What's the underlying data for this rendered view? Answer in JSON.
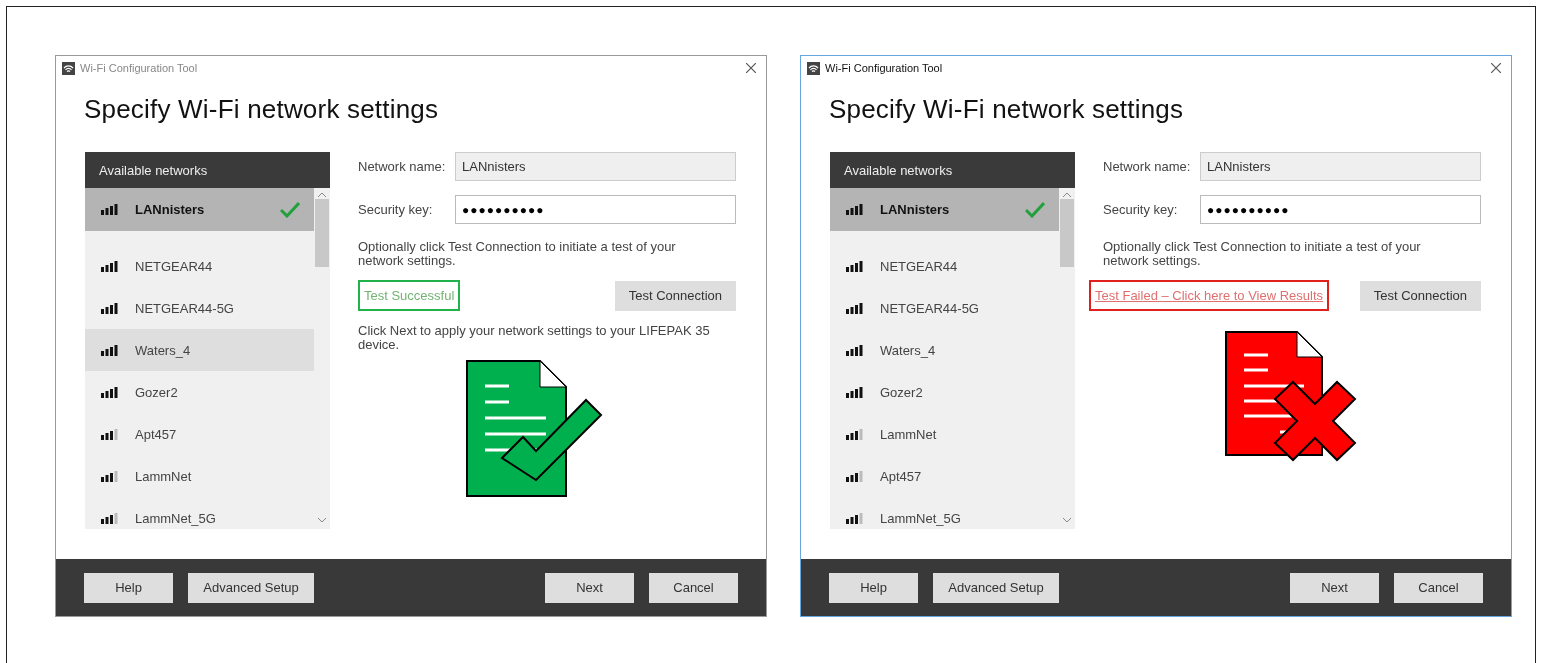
{
  "windows": [
    {
      "active": false,
      "title": "Wi-Fi Configuration Tool",
      "heading": "Specify Wi-Fi network settings",
      "networks_header": "Available networks",
      "networks": [
        {
          "name": "LANnisters",
          "selected": true,
          "hovered": false,
          "kind": "strong"
        },
        {
          "name": "NETGEAR44",
          "selected": false,
          "hovered": false,
          "kind": "strong"
        },
        {
          "name": "NETGEAR44-5G",
          "selected": false,
          "hovered": false,
          "kind": "strong"
        },
        {
          "name": "Waters_4",
          "selected": false,
          "hovered": true,
          "kind": "strong"
        },
        {
          "name": "Gozer2",
          "selected": false,
          "hovered": false,
          "kind": "strong"
        },
        {
          "name": "Apt457",
          "selected": false,
          "hovered": false,
          "kind": "weak"
        },
        {
          "name": "LammNet",
          "selected": false,
          "hovered": false,
          "kind": "weak"
        },
        {
          "name": "LammNet_5G",
          "selected": false,
          "hovered": false,
          "kind": "weak"
        }
      ],
      "network_name_label": "Network name:",
      "network_name": "LANnisters",
      "security_key_label": "Security key:",
      "security_key": "●●●●●●●●●●",
      "hint": "Optionally click Test Connection to initiate a test of your network settings.",
      "test_result": {
        "kind": "success",
        "text": "Test Successful"
      },
      "test_button": "Test Connection",
      "next_hint": "Click Next to apply your network settings to your LIFEPAK 35 device.",
      "footer_left": [
        "Help",
        "Advanced Setup"
      ],
      "footer_right": [
        "Next",
        "Cancel"
      ]
    },
    {
      "active": true,
      "title": "Wi-Fi Configuration Tool",
      "heading": "Specify Wi-Fi network settings",
      "networks_header": "Available networks",
      "networks": [
        {
          "name": "LANnisters",
          "selected": true,
          "hovered": false,
          "kind": "strong"
        },
        {
          "name": "NETGEAR44",
          "selected": false,
          "hovered": false,
          "kind": "strong"
        },
        {
          "name": "NETGEAR44-5G",
          "selected": false,
          "hovered": false,
          "kind": "strong"
        },
        {
          "name": "Waters_4",
          "selected": false,
          "hovered": false,
          "kind": "strong"
        },
        {
          "name": "Gozer2",
          "selected": false,
          "hovered": false,
          "kind": "strong"
        },
        {
          "name": "LammNet",
          "selected": false,
          "hovered": false,
          "kind": "weak"
        },
        {
          "name": "Apt457",
          "selected": false,
          "hovered": false,
          "kind": "weak"
        },
        {
          "name": "LammNet_5G",
          "selected": false,
          "hovered": false,
          "kind": "weak"
        }
      ],
      "network_name_label": "Network name:",
      "network_name": "LANnisters",
      "security_key_label": "Security key:",
      "security_key": "●●●●●●●●●●",
      "hint": "Optionally click Test Connection to initiate a test of your network settings.",
      "test_result": {
        "kind": "failure",
        "text": "Test Failed – Click here to View Results"
      },
      "test_button": "Test Connection",
      "footer_left": [
        "Help",
        "Advanced Setup"
      ],
      "footer_right": [
        "Next",
        "Cancel"
      ]
    }
  ]
}
